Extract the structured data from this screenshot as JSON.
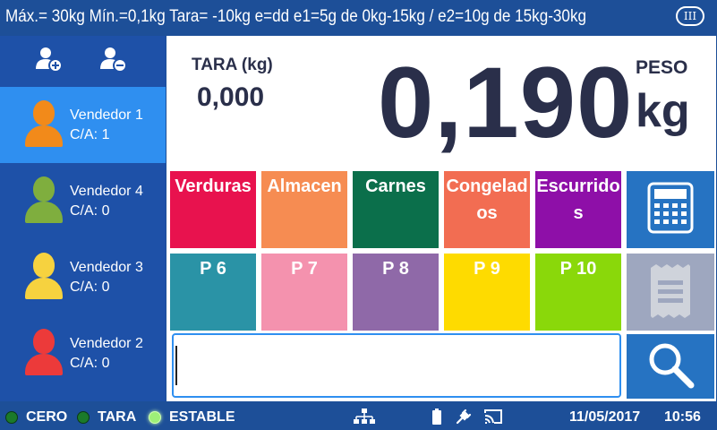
{
  "header": {
    "spec_line": "Máx.= 30kg  Mín.=0,1kg  Tara= -10kg  e=dd  e1=5g de 0kg-15kg / e2=10g de 15kg-30kg",
    "range_badge": "III"
  },
  "sidebar": {
    "add_user_icon": "user-plus-icon",
    "remove_user_icon": "user-minus-icon",
    "vendors": [
      {
        "name": "Vendedor 1",
        "ca": "C/A: 1",
        "color": "#f28a1a",
        "active": true
      },
      {
        "name": "Vendedor 4",
        "ca": "C/A: 0",
        "color": "#7fae3e",
        "active": false
      },
      {
        "name": "Vendedor 3",
        "ca": "C/A: 0",
        "color": "#f6d23f",
        "active": false
      },
      {
        "name": "Vendedor 2",
        "ca": "C/A: 0",
        "color": "#ec3a3a",
        "active": false
      }
    ]
  },
  "display": {
    "tara_label": "TARA (kg)",
    "tara_value": "0,000",
    "weight": "0,190",
    "peso_label": "PESO",
    "unit": "kg"
  },
  "categories": [
    {
      "label": "Verduras",
      "color": "#e8124e"
    },
    {
      "label": "Almacen",
      "color": "#f68c52"
    },
    {
      "label": "Carnes",
      "color": "#0b6f4b"
    },
    {
      "label": "Congelados",
      "color": "#f26d52"
    },
    {
      "label": "Escurridos",
      "color": "#8e0fa8"
    },
    {
      "label": "P 6",
      "color": "#2a93a6"
    },
    {
      "label": "P 7",
      "color": "#f492ae"
    },
    {
      "label": "P 8",
      "color": "#8f69a8"
    },
    {
      "label": "P 9",
      "color": "#fedb00"
    },
    {
      "label": "P 10",
      "color": "#8ad80a"
    }
  ],
  "tools": {
    "calculator_icon": "calculator-icon",
    "receipt_icon": "receipt-icon",
    "search_icon": "search-icon"
  },
  "search": {
    "value": ""
  },
  "status": {
    "cero": "CERO",
    "tara": "TARA",
    "estable": "ESTABLE",
    "date": "11/05/2017",
    "time": "10:56",
    "network_icon": "network-icon",
    "battery_icon": "battery-icon",
    "plug_icon": "plug-icon",
    "cast_icon": "cast-icon"
  }
}
